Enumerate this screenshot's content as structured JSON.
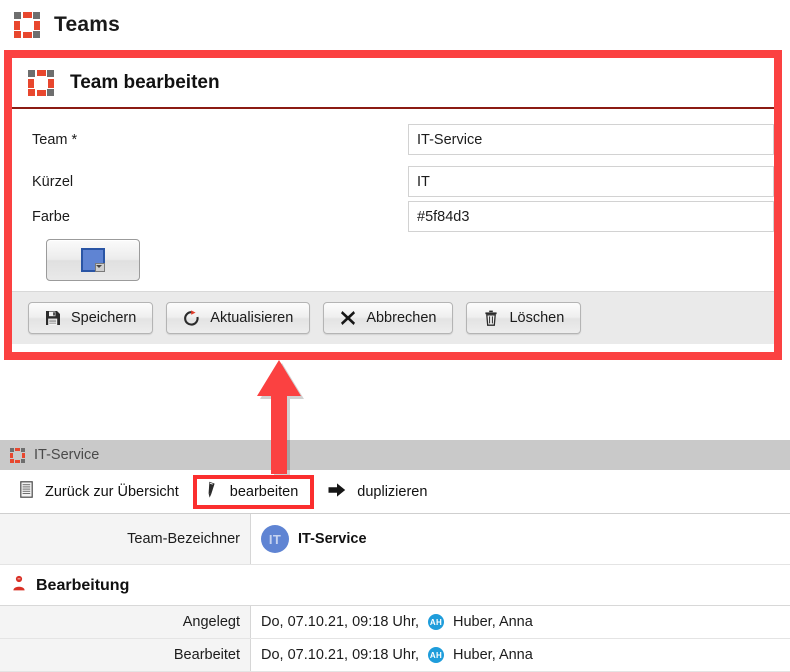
{
  "page": {
    "title": "Teams",
    "icon": "teams-icon"
  },
  "edit_panel": {
    "title": "Team bearbeiten",
    "icon": "teams-icon",
    "fields": [
      {
        "label": "Team *",
        "value": "IT-Service",
        "name": "team-name"
      },
      {
        "label": "Kürzel",
        "value": "IT",
        "name": "team-short"
      },
      {
        "label": "Farbe",
        "value": "#5f84d3",
        "name": "team-color"
      }
    ],
    "color_button": {
      "name": "color-picker-button",
      "swatch_color": "#5f84d3"
    },
    "buttons": [
      {
        "label": "Speichern",
        "icon": "save-icon",
        "name": "save-button"
      },
      {
        "label": "Aktualisieren",
        "icon": "refresh-icon",
        "name": "refresh-button"
      },
      {
        "label": "Abbrechen",
        "icon": "cancel-icon",
        "name": "cancel-button"
      },
      {
        "label": "Löschen",
        "icon": "trash-icon",
        "name": "delete-button"
      }
    ]
  },
  "detail": {
    "header_label": "IT-Service",
    "header_icon": "teams-icon",
    "toolbar": [
      {
        "label": "Zurück zur Übersicht",
        "icon": "list-icon",
        "name": "back-to-overview",
        "highlighted": false
      },
      {
        "label": "bearbeiten",
        "icon": "pencil-icon",
        "name": "edit-action",
        "highlighted": true
      },
      {
        "label": "duplizieren",
        "icon": "arrow-right-icon",
        "name": "duplicate-action",
        "highlighted": false
      }
    ],
    "rows": [
      {
        "key": "Team-Bezeichner",
        "avatar_initials": "IT",
        "value": "IT-Service"
      }
    ],
    "section": {
      "title": "Bearbeitung",
      "icon": "user-icon",
      "rows": [
        {
          "key": "Angelegt",
          "timestamp": "Do, 07.10.21, 09:18 Uhr,",
          "user_initials": "AH",
          "user": "Huber, Anna"
        },
        {
          "key": "Bearbeitet",
          "timestamp": "Do, 07.10.21, 09:18 Uhr,",
          "user_initials": "AH",
          "user": "Huber, Anna"
        }
      ]
    }
  },
  "annotations": {
    "arrow": {
      "name": "red-pointer-arrow",
      "color": "#fb4141"
    },
    "highlight_color": "#fb4141"
  }
}
